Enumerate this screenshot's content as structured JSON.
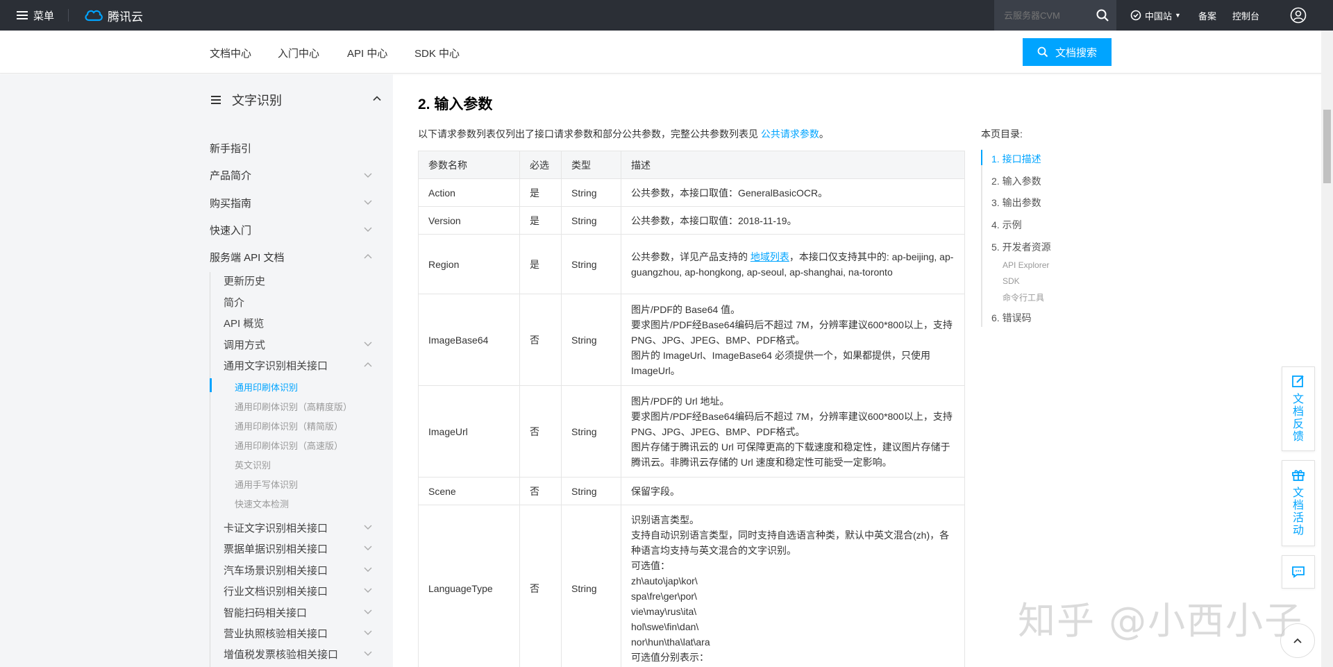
{
  "topbar": {
    "menu_label": "菜单",
    "brand": "腾讯云",
    "search_placeholder": "云服务器CVM",
    "region": "中国站",
    "links": [
      "备案",
      "控制台"
    ]
  },
  "subnav": {
    "tabs": [
      "文档中心",
      "入门中心",
      "API 中心",
      "SDK 中心"
    ],
    "search_button": "文档搜索"
  },
  "sidebar": {
    "title": "文字识别",
    "items": [
      "新手指引",
      "产品简介",
      "购买指南",
      "快速入门",
      "服务端 API 文档"
    ],
    "api_children": [
      "更新历史",
      "简介",
      "API 概览",
      "调用方式",
      "通用文字识别相关接口"
    ],
    "ocr_leaves": [
      "通用印刷体识别",
      "通用印刷体识别（高精度版）",
      "通用印刷体识别（精简版）",
      "通用印刷体识别（高速版）",
      "英文识别",
      "通用手写体识别",
      "快速文本检测"
    ],
    "more_children": [
      "卡证文字识别相关接口",
      "票据单据识别相关接口",
      "汽车场景识别相关接口",
      "行业文档识别相关接口",
      "智能扫码相关接口",
      "营业执照核验相关接口",
      "增值税发票核验相关接口"
    ]
  },
  "main": {
    "section_title": "2. 输入参数",
    "intro_text": "以下请求参数列表仅列出了接口请求参数和部分公共参数，完整公共参数列表见 ",
    "intro_link": "公共请求参数",
    "intro_end": "。",
    "table": {
      "headers": [
        "参数名称",
        "必选",
        "类型",
        "描述"
      ],
      "rows": [
        {
          "name": "Action",
          "required": "是",
          "type": "String",
          "desc": [
            "公共参数，本接口取值：GeneralBasicOCR。"
          ]
        },
        {
          "name": "Version",
          "required": "是",
          "type": "String",
          "desc": [
            "公共参数，本接口取值：2018-11-19。"
          ]
        },
        {
          "name": "Region",
          "required": "是",
          "type": "String",
          "desc_pre": "公共参数，详见产品支持的 ",
          "desc_link": "地域列表",
          "desc_post": "，本接口仅支持其中的: ap-beijing, ap-guangzhou, ap-hongkong, ap-seoul, ap-shanghai, na-toronto"
        },
        {
          "name": "ImageBase64",
          "required": "否",
          "type": "String",
          "desc": [
            "图片/PDF的 Base64 值。",
            "要求图片/PDF经Base64编码后不超过 7M，分辨率建议600*800以上，支持PNG、JPG、JPEG、BMP、PDF格式。",
            "图片的 ImageUrl、ImageBase64 必须提供一个，如果都提供，只使用 ImageUrl。"
          ]
        },
        {
          "name": "ImageUrl",
          "required": "否",
          "type": "String",
          "desc": [
            "图片/PDF的 Url 地址。",
            "要求图片/PDF经Base64编码后不超过 7M，分辨率建议600*800以上，支持PNG、JPG、JPEG、BMP、PDF格式。",
            "图片存储于腾讯云的 Url 可保障更高的下载速度和稳定性，建议图片存储于腾讯云。非腾讯云存储的 Url 速度和稳定性可能受一定影响。"
          ]
        },
        {
          "name": "Scene",
          "required": "否",
          "type": "String",
          "desc": [
            "保留字段。"
          ]
        },
        {
          "name": "LanguageType",
          "required": "否",
          "type": "String",
          "desc": [
            "识别语言类型。",
            "支持自动识别语言类型，同时支持自选语言种类，默认中英文混合(zh)，各种语言均支持与英文混合的文字识别。",
            "可选值：",
            "zh\\auto\\jap\\kor\\",
            "spa\\fre\\ger\\por\\",
            "vie\\may\\rus\\ita\\",
            "hol\\swe\\fin\\dan\\",
            "nor\\hun\\tha\\lat\\ara",
            "可选值分别表示："
          ]
        }
      ]
    }
  },
  "toc": {
    "title": "本页目录:",
    "items": [
      "1. 接口描述",
      "2. 输入参数",
      "3. 输出参数",
      "4. 示例",
      "5. 开发者资源"
    ],
    "sub_items": [
      "API Explorer",
      "SDK",
      "命令行工具"
    ],
    "last_item": "6. 错误码"
  },
  "floating": {
    "feedback": "文档反馈",
    "activity": "文档活动"
  },
  "watermark": "知乎 @小西小子",
  "colors": {
    "accent": "#00a4ff",
    "topbar_bg": "#2b2f36",
    "sidebar_bg": "#f4f5f7"
  }
}
